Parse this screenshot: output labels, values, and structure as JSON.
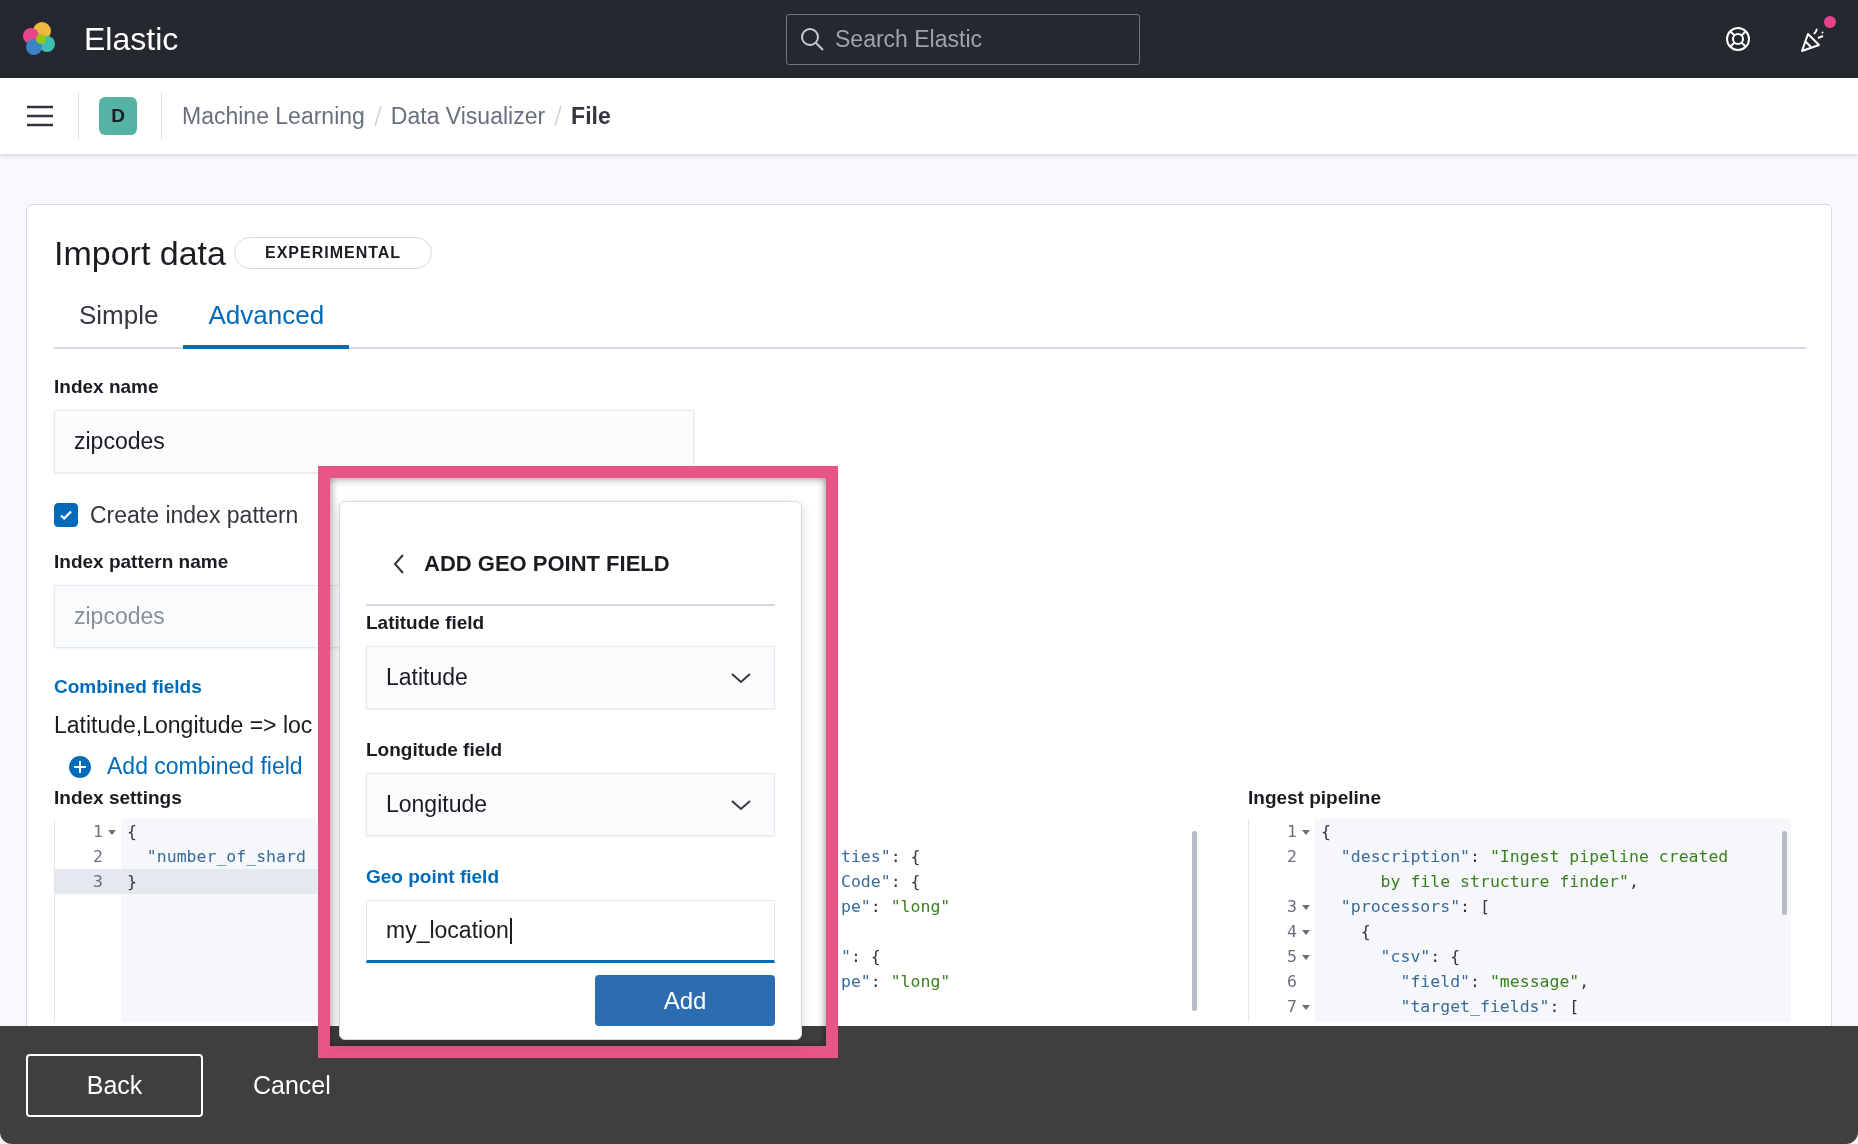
{
  "header": {
    "brand": "Elastic",
    "search": {
      "placeholder": "Search Elastic"
    },
    "news_unread": true
  },
  "breadcrumb_bar": {
    "space_avatar": "D",
    "breadcrumbs": [
      {
        "label": "Machine Learning",
        "current": false
      },
      {
        "label": "Data Visualizer",
        "current": false
      },
      {
        "label": "File",
        "current": true
      }
    ]
  },
  "import_panel": {
    "title": "Import data",
    "badge": "EXPERIMENTAL",
    "tabs": [
      {
        "label": "Simple",
        "selected": false
      },
      {
        "label": "Advanced",
        "selected": true
      }
    ],
    "index_name": {
      "label": "Index name",
      "value": "zipcodes"
    },
    "create_index_pattern": {
      "label": "Create index pattern",
      "checked": true
    },
    "index_pattern_name": {
      "label": "Index pattern name",
      "placeholder": "zipcodes"
    },
    "combined_fields": {
      "label": "Combined fields",
      "items": [
        "Latitude,Longitude => loc"
      ],
      "add_link": "Add combined field"
    },
    "editors": [
      {
        "label": "Index settings",
        "lines": [
          {
            "number": "1",
            "fold": true,
            "active": false,
            "segments": [
              {
                "kind": "punct",
                "text": "{"
              }
            ]
          },
          {
            "number": "2",
            "fold": false,
            "active": false,
            "segments": [
              {
                "kind": "key",
                "text": "  \"number_of_shard"
              }
            ]
          },
          {
            "number": "3",
            "fold": false,
            "active": true,
            "segments": [
              {
                "kind": "punct",
                "text": "}"
              }
            ]
          }
        ]
      },
      {
        "lines": [
          {
            "kind": "blank"
          },
          {
            "kind": "code",
            "segments": [
              {
                "kind": "key",
                "text": "ties\""
              },
              {
                "kind": "punct",
                "text": ": {"
              }
            ]
          },
          {
            "kind": "code",
            "segments": [
              {
                "kind": "key",
                "text": "Code\""
              },
              {
                "kind": "punct",
                "text": ": {"
              }
            ]
          },
          {
            "kind": "code",
            "segments": [
              {
                "kind": "key",
                "text": "pe\""
              },
              {
                "kind": "punct",
                "text": ": "
              },
              {
                "kind": "string",
                "text": "\"long\""
              }
            ]
          },
          {
            "kind": "blank"
          },
          {
            "kind": "code",
            "segments": [
              {
                "kind": "key",
                "text": "\""
              },
              {
                "kind": "punct",
                "text": ": {"
              }
            ]
          },
          {
            "kind": "code",
            "segments": [
              {
                "kind": "key",
                "text": "pe\""
              },
              {
                "kind": "punct",
                "text": ": "
              },
              {
                "kind": "string",
                "text": "\"long\""
              }
            ]
          }
        ]
      },
      {
        "label": "Ingest pipeline",
        "lines": [
          {
            "number": "1",
            "fold": true,
            "active": false,
            "segments": [
              {
                "kind": "punct",
                "text": "{"
              }
            ]
          },
          {
            "number": "2",
            "fold": false,
            "active": false,
            "segments": [
              {
                "kind": "key",
                "text": "  \"description\""
              },
              {
                "kind": "punct",
                "text": ": "
              },
              {
                "kind": "string",
                "text": "\"Ingest pipeline created"
              }
            ]
          },
          {
            "fold": false,
            "active": false,
            "segments": [
              {
                "kind": "string",
                "text": "      by file structure finder\""
              },
              {
                "kind": "punct",
                "text": ","
              }
            ]
          },
          {
            "number": "3",
            "fold": true,
            "active": false,
            "segments": [
              {
                "kind": "key",
                "text": "  \"processors\""
              },
              {
                "kind": "punct",
                "text": ": ["
              }
            ]
          },
          {
            "number": "4",
            "fold": true,
            "active": false,
            "segments": [
              {
                "kind": "punct",
                "text": "    {"
              }
            ]
          },
          {
            "number": "5",
            "fold": true,
            "active": false,
            "segments": [
              {
                "kind": "key",
                "text": "      \"csv\""
              },
              {
                "kind": "punct",
                "text": ": {"
              }
            ]
          },
          {
            "number": "6",
            "fold": false,
            "active": false,
            "segments": [
              {
                "kind": "key",
                "text": "        \"field\""
              },
              {
                "kind": "punct",
                "text": ": "
              },
              {
                "kind": "string",
                "text": "\"message\""
              },
              {
                "kind": "punct",
                "text": ","
              }
            ]
          },
          {
            "number": "7",
            "fold": true,
            "active": false,
            "segments": [
              {
                "kind": "key",
                "text": "        \"target_fields\""
              },
              {
                "kind": "punct",
                "text": ": ["
              }
            ]
          }
        ]
      }
    ]
  },
  "popover": {
    "title": "ADD GEO POINT FIELD",
    "fields": [
      {
        "kind": "select",
        "label": "Latitude field",
        "value": "Latitude"
      },
      {
        "kind": "select",
        "label": "Longitude field",
        "value": "Longitude"
      },
      {
        "kind": "text",
        "label": "Geo point field",
        "value": "my_location",
        "focused": true
      }
    ],
    "button": "Add"
  },
  "bottom_bar": {
    "buttons": [
      {
        "kind": "outline",
        "label": "Back"
      },
      {
        "kind": "plain",
        "label": "Cancel"
      }
    ]
  }
}
